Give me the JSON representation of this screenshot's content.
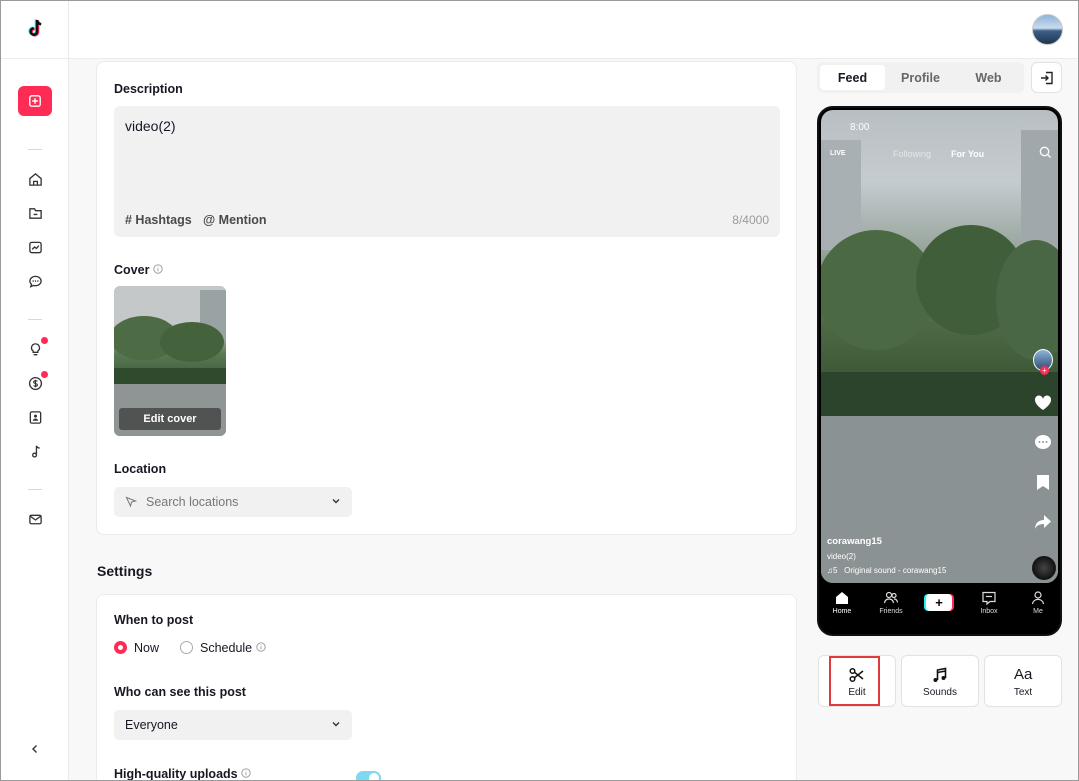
{
  "sidebar": {
    "items": [
      {
        "icon": "home-icon"
      },
      {
        "icon": "folder-icon"
      },
      {
        "icon": "analytics-icon"
      },
      {
        "icon": "comment-icon"
      },
      {
        "icon": "bulb-icon",
        "badge": true
      },
      {
        "icon": "dollar-icon",
        "badge": true
      },
      {
        "icon": "book-icon"
      },
      {
        "icon": "music-icon"
      },
      {
        "icon": "mail-icon"
      }
    ]
  },
  "description": {
    "label": "Description",
    "value": "video(2)",
    "hashtags": "# Hashtags",
    "mention": "@ Mention",
    "counter": "8/4000"
  },
  "cover": {
    "label": "Cover",
    "edit_label": "Edit cover"
  },
  "location": {
    "label": "Location",
    "placeholder": "Search locations"
  },
  "settings": {
    "heading": "Settings",
    "when_label": "When to post",
    "now_label": "Now",
    "schedule_label": "Schedule",
    "selected": "Now",
    "who_label": "Who can see this post",
    "who_value": "Everyone",
    "hq_label": "High-quality uploads",
    "hq_enabled": true
  },
  "preview": {
    "tabs": [
      "Feed",
      "Profile",
      "Web"
    ],
    "active_tab": "Feed",
    "time": "8:00",
    "live": "LIVE",
    "following": "Following",
    "for_you": "For You",
    "username": "corawang15",
    "caption": "video(2)",
    "sound": "Original sound - corawang15",
    "sound_prefix": "♫5",
    "nav": [
      "Home",
      "Friends",
      "",
      "Inbox",
      "Me"
    ]
  },
  "tools": [
    {
      "label": "Edit",
      "icon": "scissors-icon"
    },
    {
      "label": "Sounds",
      "icon": "music-note-icon"
    },
    {
      "label": "Text",
      "icon": "text-icon",
      "glyph": "Aa"
    }
  ],
  "colors": {
    "accent": "#fe2c55",
    "toggle": "#7fd7f2",
    "highlight": "#e03a3a"
  }
}
